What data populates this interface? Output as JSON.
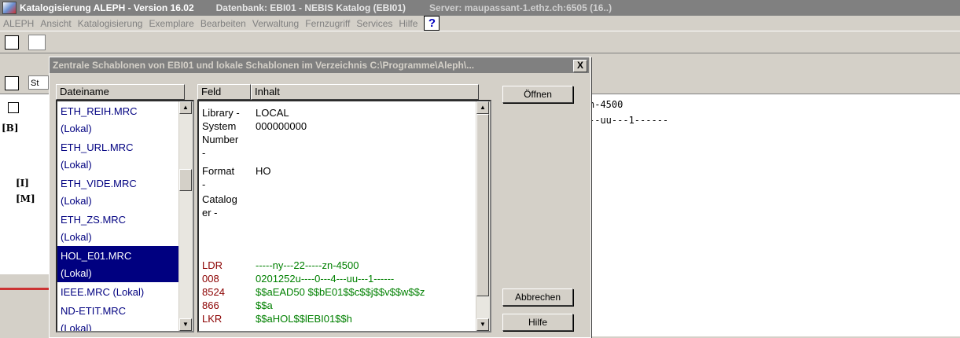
{
  "window": {
    "title": "Katalogisierung ALEPH - Version 16.02",
    "database": "Datenbank: EBI01 - NEBIS Katalog (EBI01)",
    "server": "Server: maupassant-1.ethz.ch:6505 (16..)"
  },
  "menu": [
    "ALEPH",
    "Ansicht",
    "Katalogisierung",
    "Exemplare",
    "Bearbeiten",
    "Verwaltung",
    "Fernzugriff",
    "Services",
    "Hilfe"
  ],
  "help_icon": "?",
  "toolbar": {
    "field_prefix": "St"
  },
  "tree": {
    "nodes": [
      "[B]",
      "[I]",
      "[M]"
    ]
  },
  "background_record": {
    "line1": "n-4500",
    "line2": "--uu---1------"
  },
  "dialog": {
    "title": "Zentrale Schablonen von EBI01 und lokale Schablonen im Verzeichnis C:\\Programme\\Aleph\\...",
    "close": "X",
    "files_header": "Dateiname",
    "field_header": "Feld",
    "content_header": "Inhalt",
    "files": [
      {
        "name": "ETH_REIH.MRC",
        "loc": "(Lokal)"
      },
      {
        "name": "ETH_URL.MRC",
        "loc": "(Lokal)"
      },
      {
        "name": "ETH_VIDE.MRC",
        "loc": "(Lokal)"
      },
      {
        "name": "ETH_ZS.MRC",
        "loc": "(Lokal)"
      },
      {
        "name": "HOL_E01.MRC",
        "loc": "(Lokal)"
      },
      {
        "name": "IEEE.MRC (Lokal)",
        "loc": ""
      },
      {
        "name": "ND-ETIT.MRC",
        "loc": "(Lokal)"
      }
    ],
    "selected_file_index": 4,
    "meta": {
      "library_field": "Library -",
      "library_value": "LOCAL",
      "sysno_field_1": "System",
      "sysno_field_2": "Number",
      "sysno_field_3": "-",
      "sysno_value": "000000000",
      "format_field": "Format",
      "format_dash": "-",
      "format_value": "HO",
      "cataloger_field_1": "Catalog",
      "cataloger_field_2": "er -"
    },
    "marc": [
      {
        "tag": "LDR",
        "value": "-----ny---22-----zn-4500"
      },
      {
        "tag": "008",
        "value": "0201252u----0---4---uu---1------"
      },
      {
        "tag": "8524",
        "value": "$$aEAD50 $$bE01$$c$$j$$v$$w$$z"
      },
      {
        "tag": "866",
        "value": "$$a"
      },
      {
        "tag": "LKR",
        "value": "$$aHOL$$lEBI01$$h"
      }
    ],
    "buttons": {
      "open": "Öffnen",
      "cancel": "Abbrechen",
      "help": "Hilfe"
    }
  },
  "colors": {
    "titlebar_bg": "#808080",
    "selection": "#000080",
    "marc_tag": "#8b0000",
    "marc_value": "#008000",
    "file_text": "#000080"
  }
}
